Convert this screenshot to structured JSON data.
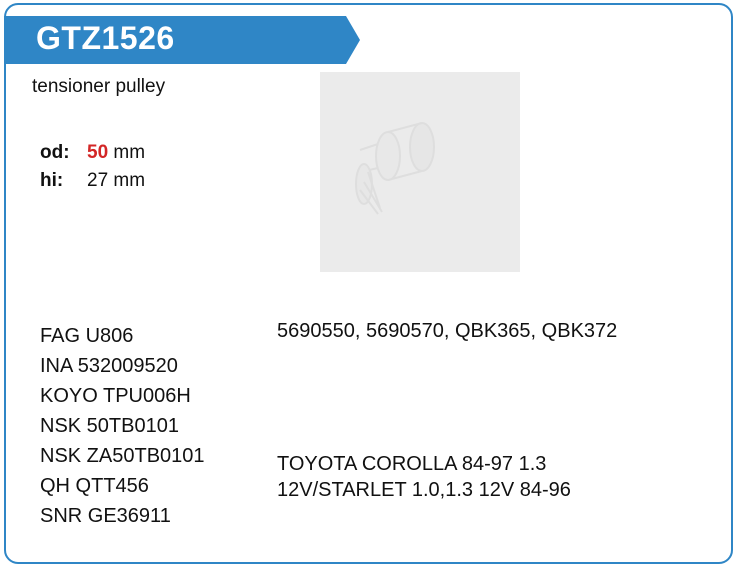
{
  "product": {
    "code": "GTZ1526",
    "type": "tensioner pulley"
  },
  "dimensions": {
    "od": {
      "label": "od:",
      "value": "50",
      "unit": "mm"
    },
    "hi": {
      "label": "hi:",
      "value": "27 mm"
    }
  },
  "cross_references": [
    "FAG U806",
    "INA 532009520",
    "KOYO TPU006H",
    "NSK 50TB0101",
    "NSK ZA50TB0101",
    "QH QTT456",
    "SNR GE36911"
  ],
  "oe_numbers": "5690550, 5690570, QBK365, QBK372",
  "applications": [
    "TOYOTA COROLLA 84-97 1.3",
    "12V/STARLET 1.0,1.3 12V 84-96"
  ],
  "colors": {
    "accent": "#2f86c6",
    "highlight": "#d32626"
  }
}
